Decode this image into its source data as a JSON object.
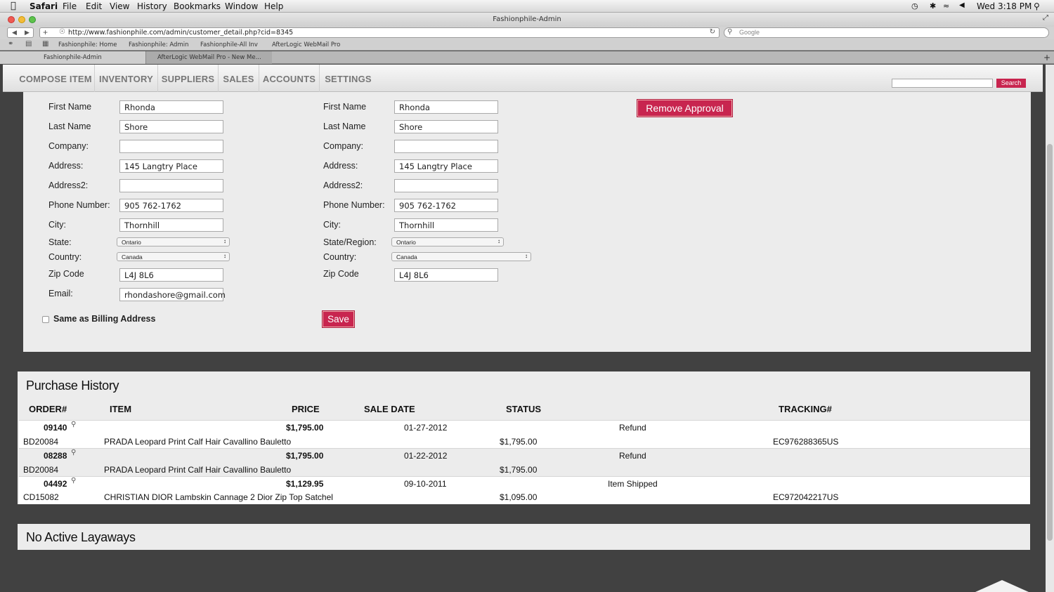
{
  "menubar": {
    "apple": "",
    "app": "Safari",
    "items": [
      "File",
      "Edit",
      "View",
      "History",
      "Bookmarks",
      "Window",
      "Help"
    ],
    "clock": "Wed 3:18 PM"
  },
  "window": {
    "title": "Fashionphile-Admin",
    "url": "http://www.fashionphile.com/admin/customer_detail.php?cid=8345",
    "search_placeholder": "Google"
  },
  "bookmarks": [
    "Fashionphile: Home",
    "Fashionphile: Admin",
    "Fashionphile-All Inv",
    "AfterLogic WebMail Pro"
  ],
  "tabs": [
    "Fashionphile-Admin",
    "AfterLogic WebMail Pro - New Me..."
  ],
  "nav": {
    "items": [
      "COMPOSE ITEM",
      "INVENTORY",
      "SUPPLIERS",
      "SALES",
      "ACCOUNTS",
      "SETTINGS"
    ],
    "search_button": "Search"
  },
  "billing": {
    "first_name_label": "First Name",
    "first_name": "Rhonda",
    "last_name_label": "Last Name",
    "last_name": "Shore",
    "company_label": "Company:",
    "company": "",
    "address_label": "Address:",
    "address": "145 Langtry Place",
    "address2_label": "Address2:",
    "address2": "",
    "phone_label": "Phone Number:",
    "phone": "905 762-1762",
    "city_label": "City:",
    "city": "Thornhill",
    "state_label": "State:",
    "state": "Ontario",
    "country_label": "Country:",
    "country": "Canada",
    "zip_label": "Zip Code",
    "zip": "L4J 8L6",
    "email_label": "Email:",
    "email": "rhondashore@gmail.com",
    "same_as_billing": "Same as Billing Address"
  },
  "shipping": {
    "first_name_label": "First Name",
    "first_name": "Rhonda",
    "last_name_label": "Last Name",
    "last_name": "Shore",
    "company_label": "Company:",
    "company": "",
    "address_label": "Address:",
    "address": "145 Langtry Place",
    "address2_label": "Address2:",
    "address2": "",
    "phone_label": "Phone Number:",
    "phone": "905 762-1762",
    "city_label": "City:",
    "city": "Thornhill",
    "state_label": "State/Region:",
    "state": "Ontario",
    "country_label": "Country:",
    "country": "Canada",
    "zip_label": "Zip Code",
    "zip": "L4J 8L6",
    "save_button": "Save"
  },
  "remove_approval_button": "Remove Approval",
  "purchase_history": {
    "title": "Purchase History",
    "columns": [
      "ORDER#",
      "ITEM",
      "PRICE",
      "SALE DATE",
      "STATUS",
      "TRACKING#"
    ],
    "rows": [
      {
        "order": "09140",
        "price": "$1,795.00",
        "date": "01-27-2012",
        "status": "Refund",
        "sku": "BD20084",
        "item": "PRADA Leopard Print Calf Hair Cavallino Bauletto",
        "amount": "$1,795.00",
        "tracking": "EC976288365US"
      },
      {
        "order": "08288",
        "price": "$1,795.00",
        "date": "01-22-2012",
        "status": "Refund",
        "sku": "BD20084",
        "item": "PRADA Leopard Print Calf Hair Cavallino Bauletto",
        "amount": "$1,795.00",
        "tracking": ""
      },
      {
        "order": "04492",
        "price": "$1,129.95",
        "date": "09-10-2011",
        "status": "Item Shipped",
        "sku": "CD15082",
        "item": "CHRISTIAN DIOR Lambskin Cannage 2 Dior Zip Top Satchel",
        "amount": "$1,095.00",
        "tracking": "EC972042217US"
      }
    ]
  },
  "layaways": {
    "title": "No Active Layaways"
  }
}
